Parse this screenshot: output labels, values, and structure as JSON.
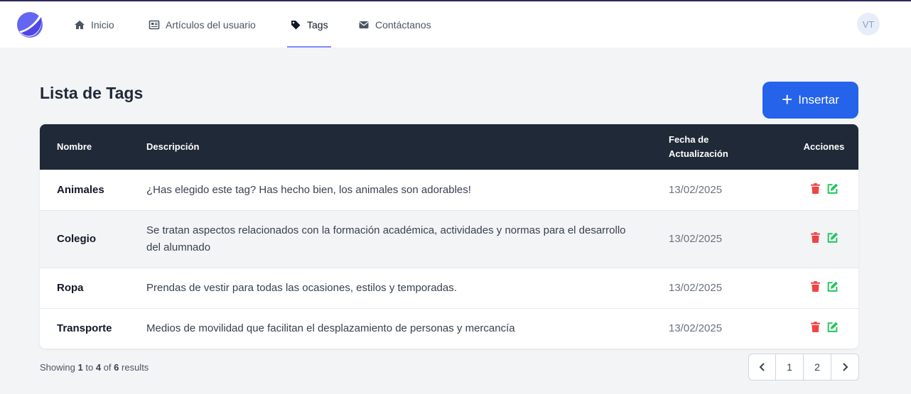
{
  "nav": {
    "items": [
      {
        "label": "Inicio",
        "icon": "home-icon"
      },
      {
        "label": "Artículos del usuario",
        "icon": "newspaper-icon"
      },
      {
        "label": "Tags",
        "icon": "tag-icon",
        "active": true
      },
      {
        "label": "Contáctanos",
        "icon": "envelope-icon"
      }
    ],
    "avatar": "VT"
  },
  "page": {
    "title": "Lista de Tags",
    "insert_label": "Insertar"
  },
  "table": {
    "headers": {
      "name": "Nombre",
      "desc": "Descripción",
      "date_line1": "Fecha de",
      "date_line2": "Actualización",
      "actions": "Acciones"
    },
    "rows": [
      {
        "name": "Animales",
        "desc": "¿Has elegido este tag? Has hecho bien, los animales son adorables!",
        "date": "13/02/2025"
      },
      {
        "name": "Colegio",
        "desc": "Se tratan aspectos relacionados con la formación académica, actividades y normas para el desarrollo del alumnado",
        "date": "13/02/2025"
      },
      {
        "name": "Ropa",
        "desc": "Prendas de vestir para todas las ocasiones, estilos y temporadas.",
        "date": "13/02/2025"
      },
      {
        "name": "Transporte",
        "desc": "Medios de movilidad que facilitan el desplazamiento de personas y mercancía",
        "date": "13/02/2025"
      }
    ]
  },
  "footer": {
    "showing": "Showing",
    "from": "1",
    "to_word": "to",
    "to": "4",
    "of_word": "of",
    "total": "6",
    "results": "results"
  },
  "pagination": {
    "prev": "‹",
    "pages": [
      "1",
      "2"
    ],
    "next": "›"
  },
  "colors": {
    "accent": "#2563eb",
    "header_bg": "#1f2937",
    "delete": "#ef4444",
    "edit": "#22c55e"
  }
}
